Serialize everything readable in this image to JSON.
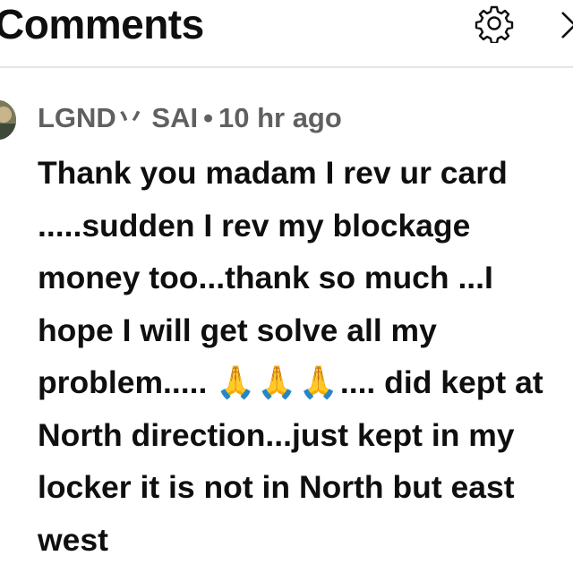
{
  "header": {
    "title": "Comments"
  },
  "icons": {
    "settings": "gear-icon",
    "close": "chevron-right-icon"
  },
  "comment": {
    "author": "LGND丷 SAI",
    "separator": "•",
    "time": "10 hr ago",
    "text_before": "Thank you madam I rev ur card .....sudden I rev my blockage money too...thank so much ...I hope I will get solve all my problem..... ",
    "emoji": "🙏🙏🙏",
    "text_after": ".... did kept at North direction...just kept in my locker it is not in North but east west"
  }
}
